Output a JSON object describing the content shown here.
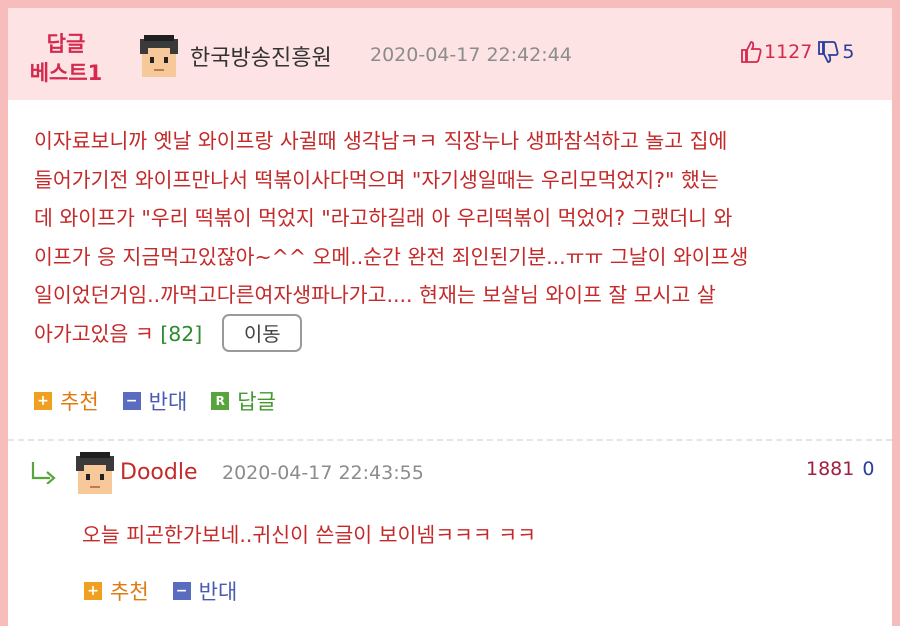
{
  "best_comment": {
    "badge_line1": "답글",
    "badge_line2": "베스트1",
    "author": "한국방송진흥원",
    "timestamp": "2020-04-17 22:42:44",
    "upvotes": "1127",
    "downvotes": "5",
    "body_lines": [
      "이자료보니까 옛날 와이프랑 사귈때 생각남ㅋㅋ 직장누나 생파참석하고 놀고 집에",
      "들어가기전 와이프만나서 떡볶이사다먹으며 \"자기생일때는 우리모먹었지?\" 했는",
      "데 와이프가 \"우리 떡볶이 먹었지 \"라고하길래 아 우리떡볶이 먹었어? 그랬더니 와",
      "이프가 응 지금먹고있잖아~^^ 오메..순간 완전 죄인된기분...ㅠㅠ 그날이 와이프생",
      "일이었던거임..까먹고다른여자생파나가고.... 현재는 보살님 와이프 잘 모시고 살"
    ],
    "last_line": "아가고있음 ㅋ",
    "reply_count": "[82]",
    "move_button": "이동",
    "actions": {
      "recommend": "추천",
      "oppose": "반대",
      "reply": "답글"
    }
  },
  "reply_comment": {
    "author": "Doodle",
    "timestamp": "2020-04-17 22:43:55",
    "upvotes": "1881",
    "downvotes": "0",
    "body": "오늘 피곤한가보네..귀신이 쓴글이 보이넴ㅋㅋㅋ ㅋㅋ",
    "actions": {
      "recommend": "추천",
      "oppose": "반대"
    }
  },
  "colors": {
    "badge": "#d42a4e",
    "body_text": "#c42a2a",
    "upvote": "#d42a4e",
    "downvote": "#2a3e9c",
    "header_bg": "#fde3e3",
    "frame": "#f7bcbc"
  },
  "icons": [
    "avatar-icon",
    "thumbs-up-icon",
    "thumbs-down-icon",
    "plus-icon",
    "minus-icon",
    "reply-r-icon",
    "reply-arrow-icon"
  ]
}
